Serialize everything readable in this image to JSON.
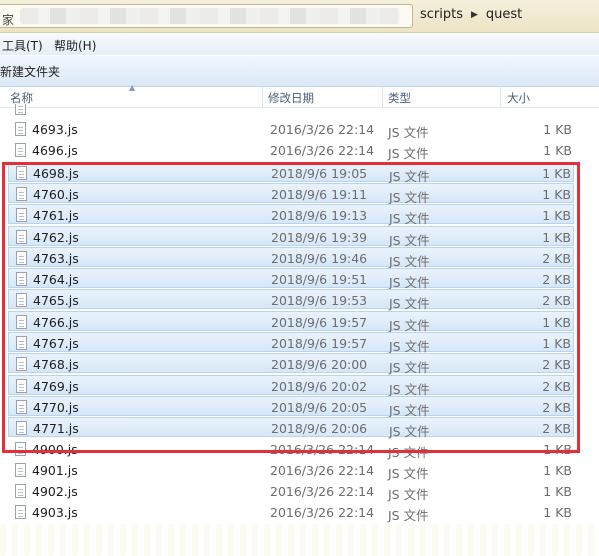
{
  "addressbar": {
    "lead_char": "家",
    "path": [
      "scripts",
      "quest"
    ]
  },
  "menu": {
    "tools": "工具(T)",
    "help": "帮助(H)"
  },
  "toolbar": {
    "new_folder": "新建文件夹"
  },
  "columns": {
    "name": "名称",
    "modified": "修改日期",
    "type": "类型",
    "size": "大小"
  },
  "files": [
    {
      "name": "4693.js",
      "date": "2016/3/26 22:14",
      "type": "JS 文件",
      "size": "1 KB",
      "selected": false
    },
    {
      "name": "4696.js",
      "date": "2016/3/26 22:14",
      "type": "JS 文件",
      "size": "1 KB",
      "selected": false
    },
    {
      "name": "4698.js",
      "date": "2018/9/6 19:05",
      "type": "JS 文件",
      "size": "1 KB",
      "selected": true
    },
    {
      "name": "4760.js",
      "date": "2018/9/6 19:11",
      "type": "JS 文件",
      "size": "1 KB",
      "selected": true
    },
    {
      "name": "4761.js",
      "date": "2018/9/6 19:13",
      "type": "JS 文件",
      "size": "1 KB",
      "selected": true
    },
    {
      "name": "4762.js",
      "date": "2018/9/6 19:39",
      "type": "JS 文件",
      "size": "1 KB",
      "selected": true
    },
    {
      "name": "4763.js",
      "date": "2018/9/6 19:46",
      "type": "JS 文件",
      "size": "2 KB",
      "selected": true
    },
    {
      "name": "4764.js",
      "date": "2018/9/6 19:51",
      "type": "JS 文件",
      "size": "2 KB",
      "selected": true
    },
    {
      "name": "4765.js",
      "date": "2018/9/6 19:53",
      "type": "JS 文件",
      "size": "2 KB",
      "selected": true
    },
    {
      "name": "4766.js",
      "date": "2018/9/6 19:57",
      "type": "JS 文件",
      "size": "1 KB",
      "selected": true
    },
    {
      "name": "4767.js",
      "date": "2018/9/6 19:57",
      "type": "JS 文件",
      "size": "1 KB",
      "selected": true
    },
    {
      "name": "4768.js",
      "date": "2018/9/6 20:00",
      "type": "JS 文件",
      "size": "2 KB",
      "selected": true
    },
    {
      "name": "4769.js",
      "date": "2018/9/6 20:02",
      "type": "JS 文件",
      "size": "2 KB",
      "selected": true
    },
    {
      "name": "4770.js",
      "date": "2018/9/6 20:05",
      "type": "JS 文件",
      "size": "2 KB",
      "selected": true
    },
    {
      "name": "4771.js",
      "date": "2018/9/6 20:06",
      "type": "JS 文件",
      "size": "2 KB",
      "selected": true
    },
    {
      "name": "4900.js",
      "date": "2016/3/26 22:14",
      "type": "JS 文件",
      "size": "1 KB",
      "selected": false
    },
    {
      "name": "4901.js",
      "date": "2016/3/26 22:14",
      "type": "JS 文件",
      "size": "1 KB",
      "selected": false
    },
    {
      "name": "4902.js",
      "date": "2016/3/26 22:14",
      "type": "JS 文件",
      "size": "1 KB",
      "selected": false
    },
    {
      "name": "4903.js",
      "date": "2016/3/26 22:14",
      "type": "JS 文件",
      "size": "1 KB",
      "selected": false
    }
  ],
  "colors": {
    "highlight_border": "#e52e3a",
    "selection_fill": "#d6e7f8"
  }
}
